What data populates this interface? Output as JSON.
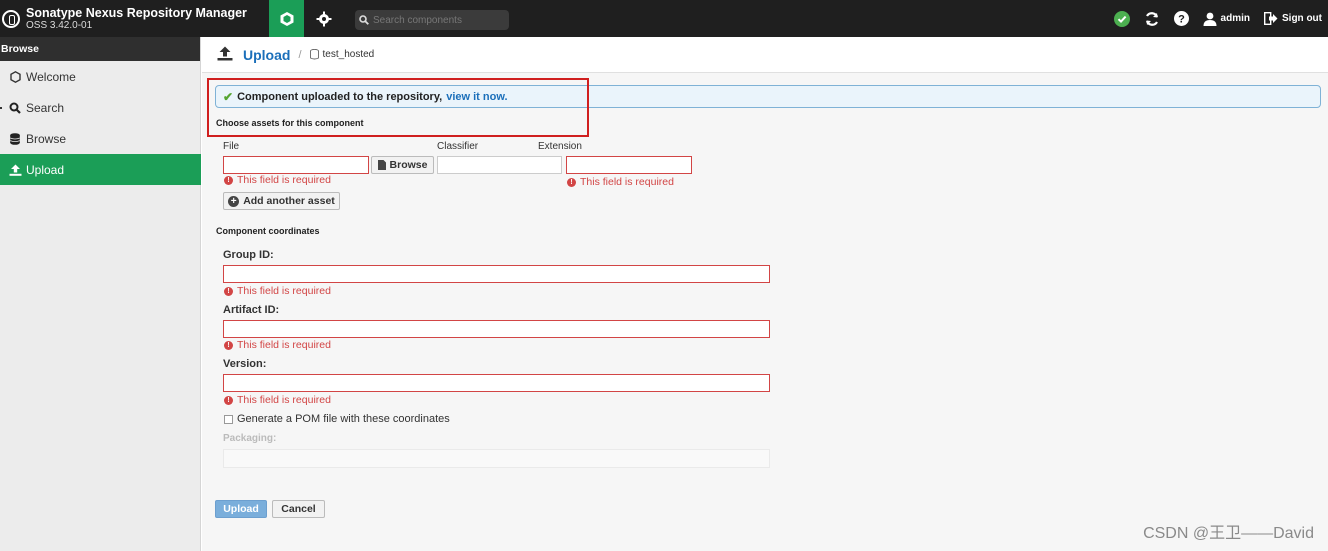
{
  "header": {
    "app_title": "Sonatype Nexus Repository Manager",
    "version": "OSS 3.42.0-01",
    "search_placeholder": "Search components",
    "user": "admin",
    "signout": "Sign out"
  },
  "sidebar": {
    "heading": "Browse",
    "items": [
      {
        "label": "Welcome",
        "icon": "hexagon-icon",
        "active": false
      },
      {
        "label": "Search",
        "icon": "search-icon",
        "active": false
      },
      {
        "label": "Browse",
        "icon": "database-icon",
        "active": false
      },
      {
        "label": "Upload",
        "icon": "upload-icon",
        "active": true
      }
    ]
  },
  "breadcrumb": {
    "title": "Upload",
    "separator": "/",
    "repository": "test_hosted"
  },
  "banner": {
    "message": "Component uploaded to the repository,",
    "link": "view it now."
  },
  "assets": {
    "section_title": "Choose assets for this component",
    "file_label": "File",
    "classifier_label": "Classifier",
    "extension_label": "Extension",
    "browse_label": "Browse",
    "file_error": "This field is required",
    "extension_error": "This field is required",
    "add_asset_label": "Add another asset"
  },
  "coordinates": {
    "section_title": "Component coordinates",
    "group_label": "Group ID:",
    "group_error": "This field is required",
    "artifact_label": "Artifact ID:",
    "artifact_error": "This field is required",
    "version_label": "Version:",
    "version_error": "This field is required",
    "pom_label": "Generate a POM file with these coordinates",
    "packaging_label": "Packaging:"
  },
  "actions": {
    "upload": "Upload",
    "cancel": "Cancel"
  },
  "watermark": "CSDN @王卫——David",
  "colors": {
    "brand_green": "#1b9e57",
    "link_blue": "#1b6fba",
    "error_red": "#d24545",
    "header_bg": "#1f1f1f"
  }
}
